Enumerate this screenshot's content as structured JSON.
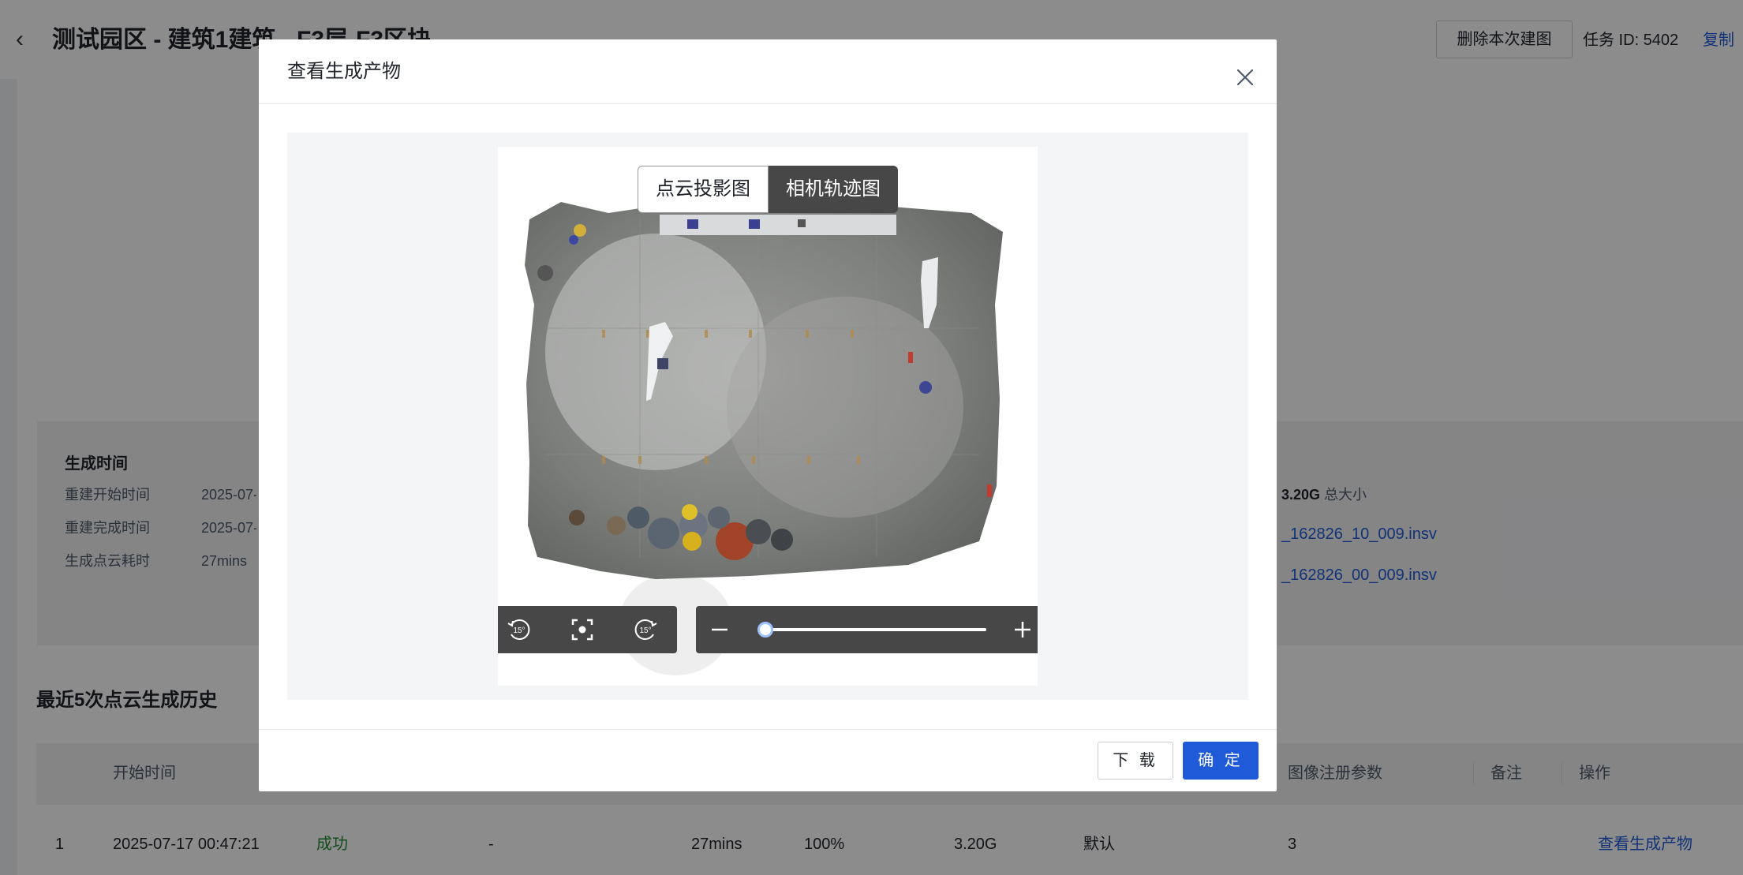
{
  "header": {
    "back_icon": "chevron-left-icon",
    "title": "测试园区 - 建筑1建筑 - F3层-F3区块",
    "delete_button": "删除本次建图",
    "task_id": "任务 ID: 5402",
    "copy_link": "复制"
  },
  "info": {
    "heading": "生成时间",
    "rows": [
      {
        "label": "重建开始时间",
        "value": "2025-07-"
      },
      {
        "label": "重建完成时间",
        "value": "2025-07-"
      },
      {
        "label": "生成点云耗时",
        "value": "27mins"
      }
    ],
    "size_value": "3.20G",
    "size_label": "总大小",
    "files": [
      "_162826_10_009.insv",
      "_162826_00_009.insv"
    ]
  },
  "history": {
    "title": "最近5次点云生成历史",
    "columns": [
      "开始时间",
      "图像注册参数",
      "备注",
      "操作"
    ],
    "row": {
      "index": "1",
      "start_time": "2025-07-17 00:47:21",
      "status": "成功",
      "dash": "-",
      "duration": "27mins",
      "progress": "100%",
      "size": "3.20G",
      "mode": "默认",
      "reg_param": "3",
      "action": "查看生成产物"
    }
  },
  "modal": {
    "title": "查看生成产物",
    "close_icon": "close-icon",
    "tabs": [
      {
        "label": "点云投影图",
        "active": false
      },
      {
        "label": "相机轨迹图",
        "active": true
      }
    ],
    "controls": {
      "rotate_left_icon": "rotate-left-15-icon",
      "focus_icon": "focus-center-icon",
      "rotate_right_icon": "rotate-right-15-icon",
      "rotate_step": "15°",
      "zoom_out_icon": "minus-icon",
      "zoom_in_icon": "plus-icon",
      "zoom_level": 0.0
    },
    "download_button": "下 载",
    "confirm_button": "确 定"
  },
  "colors": {
    "primary": "#1f5bd8",
    "success": "#1f8a36",
    "control_bg": "#474747",
    "mask": "rgba(0,0,0,0.45)"
  }
}
